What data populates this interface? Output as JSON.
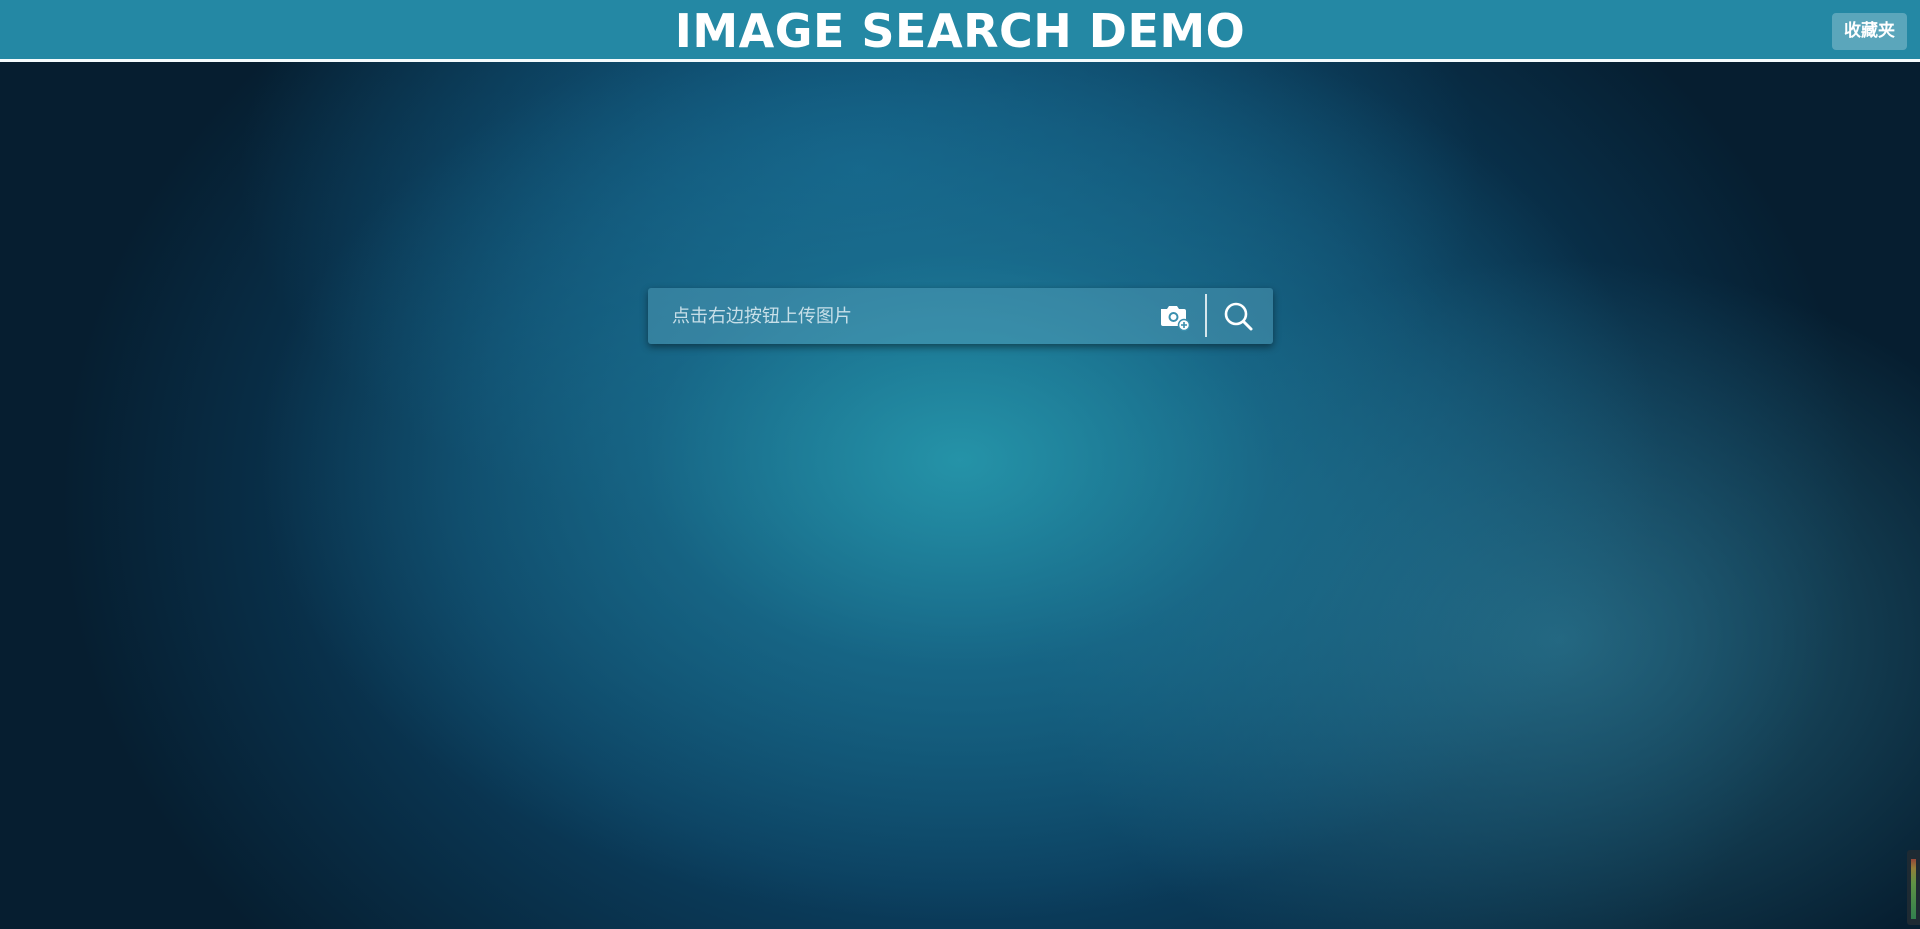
{
  "header": {
    "title": "IMAGE SEARCH DEMO",
    "favorites_label": "收藏夹"
  },
  "search": {
    "placeholder": "点击右边按钮上传图片",
    "value": "",
    "upload_icon": "camera-upload-icon",
    "search_icon": "search-icon"
  },
  "colors": {
    "header_bg": "#2488a4",
    "page_bg_center": "#2696aa",
    "page_bg_edge": "#061e30"
  }
}
